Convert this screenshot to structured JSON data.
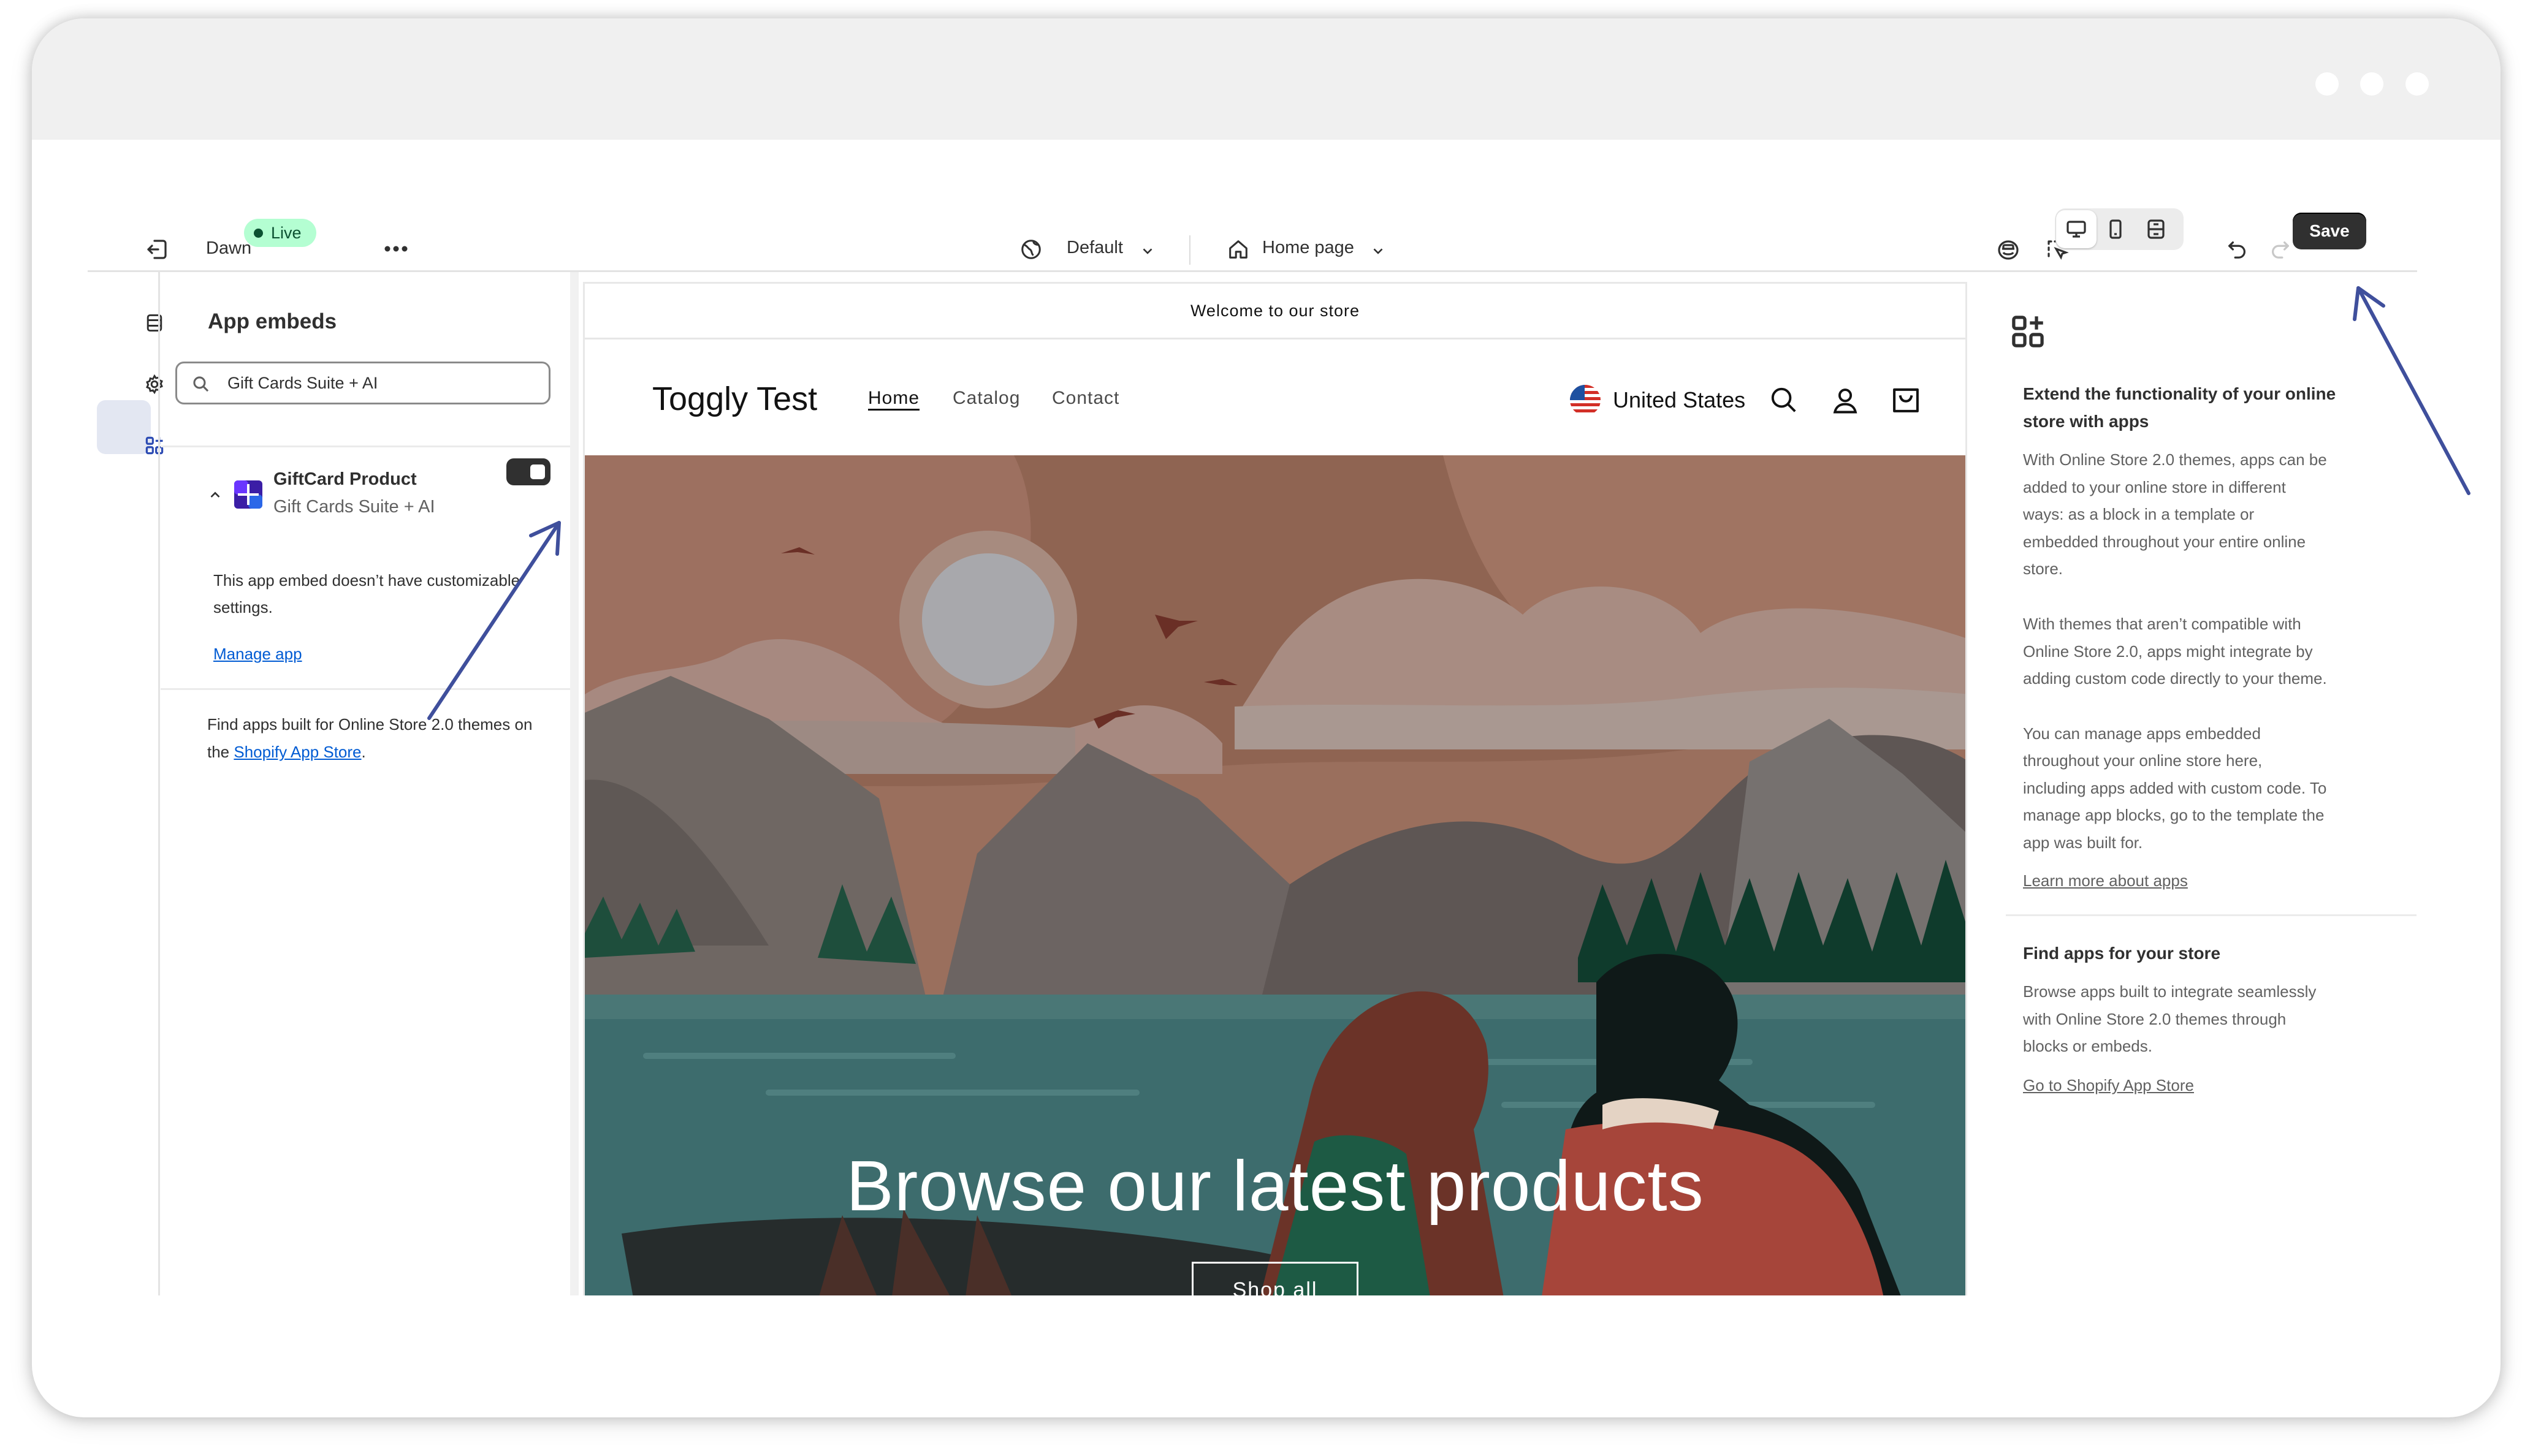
{
  "topbar": {
    "theme_name": "Dawn",
    "live_badge": "Live",
    "more_icon": "ellipsis-icon",
    "locale": "Default",
    "template": "Home page",
    "save_label": "Save"
  },
  "left_panel": {
    "title": "App embeds",
    "search_value": "Gift Cards Suite + AI",
    "app": {
      "name": "GiftCard Product",
      "vendor": "Gift Cards Suite + AI",
      "enabled": true,
      "note": [
        "This app embed doesn’t have customizable",
        "settings."
      ],
      "manage_link": "Manage app"
    },
    "footer": {
      "line1": "Find apps built for Online Store 2.0 themes on",
      "line2_prefix": "the ",
      "link": "Shopify App Store",
      "line2_suffix": "."
    }
  },
  "preview": {
    "announcement": "Welcome to our store",
    "store_name": "Toggly Test",
    "nav": [
      "Home",
      "Catalog",
      "Contact"
    ],
    "country": "United States",
    "hero_title": "Browse our latest products",
    "hero_button": "Shop all"
  },
  "right_panel": {
    "section1_title": [
      "Extend the functionality of your online",
      "store with apps"
    ],
    "para1": [
      "With Online Store 2.0 themes, apps can be",
      "added to your online store in different",
      "ways: as a block in a template or",
      "embedded throughout your entire online",
      "store."
    ],
    "para2": [
      "With themes that aren’t compatible with",
      "Online Store 2.0, apps might integrate by",
      "adding custom code directly to your theme."
    ],
    "para3": [
      "You can manage apps embedded",
      "throughout your online store here,",
      "including apps added with custom code. To",
      "manage app blocks, go to the template the",
      "app was built for."
    ],
    "learn_link": "Learn more about apps",
    "section2_title": "Find apps for your store",
    "para4": [
      "Browse apps built to integrate seamlessly",
      "with Online Store 2.0 themes through",
      "blocks or embeds."
    ],
    "store_link": "Go to Shopify App Store"
  },
  "colors": {
    "annotation_arrow": "#3f4f9c",
    "toggle_on": "#303030",
    "link": "#005bd3",
    "live_badge_bg": "#b4fed2"
  }
}
